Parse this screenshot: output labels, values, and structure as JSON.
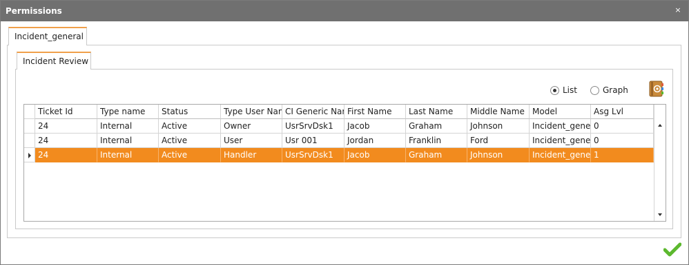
{
  "window": {
    "title": "Permissions",
    "close_glyph": "×"
  },
  "outer_tab": {
    "label": "Incident_general"
  },
  "inner_tab": {
    "label": "Incident Review"
  },
  "view_mode": {
    "options": [
      {
        "label": "List",
        "checked": true
      },
      {
        "label": "Graph",
        "checked": false
      }
    ],
    "contact_icon": "address-book-icon"
  },
  "grid": {
    "columns": [
      "Ticket Id",
      "Type name",
      "Status",
      "Type User Nam",
      "CI Generic Nar",
      "First Name",
      "Last Name",
      "Middle Name",
      "Model",
      "Asg Lvl"
    ],
    "rows": [
      [
        "24",
        "Internal",
        "Active",
        "Owner",
        "UsrSrvDsk1",
        "Jacob",
        "Graham",
        "Johnson",
        "Incident_gener",
        "0"
      ],
      [
        "24",
        "Internal",
        "Active",
        "User",
        "Usr 001",
        "Jordan",
        "Franklin",
        "Ford",
        "Incident_gener",
        "0"
      ],
      [
        "24",
        "Internal",
        "Active",
        "Handler",
        "UsrSrvDsk1",
        "Jacob",
        "Graham",
        "Johnson",
        "Incident_gener",
        "1"
      ]
    ],
    "selected_row": 2,
    "selection_color": "#f28b1e"
  },
  "footer": {
    "confirm_icon": "checkmark-icon",
    "confirm_color": "#5cb82e"
  },
  "colors": {
    "titlebar": "#707070",
    "tab_accent": "#f0a04a"
  }
}
